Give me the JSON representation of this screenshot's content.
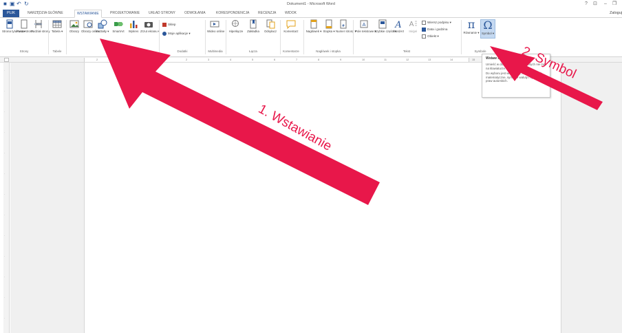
{
  "window": {
    "title": "Dokument1 - Microsoft Word",
    "help": "?",
    "minimize": "–",
    "user": "Zaloguj"
  },
  "qat": {
    "save": "▣",
    "undo": "↶",
    "redo": "↻"
  },
  "tabs": {
    "file": "PLIK",
    "items": [
      "NARZĘDZIA GŁÓWNE",
      "WSTAWIANIE",
      "PROJEKTOWANIE",
      "UKŁAD STRONY",
      "ODWOŁANIA",
      "KORESPONDENCJA",
      "RECENZJA",
      "WIDOK"
    ],
    "active": "WSTAWIANIE"
  },
  "ribbon": {
    "pages": {
      "label": "Strony",
      "cover": "Strona tytułowa ▾",
      "blank": "Pusta strona",
      "break": "Podział strony"
    },
    "tables": {
      "label": "Tabele",
      "table": "Tabela ▾"
    },
    "illustrations": {
      "label": "Ilustracje",
      "pictures": "Obrazy",
      "online": "Obrazy online",
      "shapes": "Kształty ▾",
      "smartart": "SmartArt",
      "chart": "Wykres",
      "screenshot": "Zrzut ekranu ▾"
    },
    "addins": {
      "label": "Dodatki",
      "store": "Sklep",
      "myapps": "Moje aplikacje ▾"
    },
    "media": {
      "label": "Multimedia",
      "video": "Wideo online"
    },
    "links": {
      "label": "Łącza",
      "hyperlink": "Hiperłącze",
      "bookmark": "Zakładka",
      "crossref": "Odsyłacz"
    },
    "comments": {
      "label": "Komentarze",
      "comment": "Komentarz"
    },
    "headerfooter": {
      "label": "Nagłówek i stopka",
      "header": "Nagłówek ▾",
      "footer": "Stopka ▾",
      "pagenum": "Numer strony ▾"
    },
    "text": {
      "label": "Tekst",
      "textbox": "Pole tekstowe ▾",
      "quickparts": "Szybkie części ▾",
      "wordart": "WordArt",
      "dropcap": "Inicjał",
      "signature": "Wiersz podpisu ▾",
      "datetime": "Data i godzina",
      "object": "Obiekt ▾"
    },
    "symbols": {
      "label": "Symbole",
      "equation": "Równanie ▾",
      "symbol": "Symbol ▾"
    }
  },
  "tooltip": {
    "title": "Wstaw symbol",
    "text1": "Umieść w dokumencie znaki, których nie ma na klawiaturze.",
    "text2": "Do wyboru jest wiele opcji, w tym symbole matematyczne, symbole waluty i symbole praw autorskich."
  },
  "ruler": {
    "ticks": [
      "2",
      "1",
      "1",
      "2",
      "3",
      "4",
      "5",
      "6",
      "7",
      "8",
      "9",
      "10",
      "11",
      "12",
      "13",
      "14",
      "15"
    ]
  },
  "annotations": {
    "step1": "1. Wstawianie",
    "step2": "2. Symbol",
    "color": "#e8174a"
  }
}
